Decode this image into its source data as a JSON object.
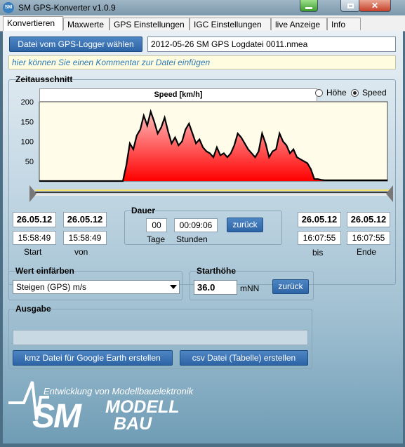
{
  "window": {
    "title": "SM GPS-Konverter v1.0.9",
    "icon_text": "SM",
    "close_symbol": "✕"
  },
  "tabs": [
    {
      "label": "Konvertieren",
      "active": true
    },
    {
      "label": "Maxwerte"
    },
    {
      "label": "GPS Einstellungen"
    },
    {
      "label": "IGC Einstellungen"
    },
    {
      "label": "live Anzeige"
    },
    {
      "label": "Info"
    }
  ],
  "file": {
    "button_label": "Datei vom GPS-Logger wählen",
    "filename": "2012-05-26 SM GPS Logdatei 0011.nmea",
    "comment_placeholder": "hier können Sie einen Kommentar zur Datei einfügen"
  },
  "zeitausschnitt": {
    "title": "Zeitausschnitt",
    "radio_hoehe": "Höhe",
    "radio_speed": "Speed",
    "selected": "Speed",
    "start_date": "26.05.12",
    "start_time": "15:58:49",
    "start_label": "Start",
    "von_date": "26.05.12",
    "von_time": "15:58:49",
    "von_label": "von",
    "dauer_title": "Dauer",
    "tage_value": "00",
    "stunden_value": "00:09:06",
    "tage_label": "Tage",
    "stunden_label": "Stunden",
    "zurueck_label": "zurück",
    "bis_date": "26.05.12",
    "bis_time": "16:07:55",
    "bis_label": "bis",
    "ende_date": "26.05.12",
    "ende_time": "16:07:55",
    "ende_label": "Ende"
  },
  "chart_data": {
    "type": "area",
    "title": "Speed [km/h]",
    "ylim": [
      0,
      200
    ],
    "yticks": [
      "200",
      "150",
      "100",
      "50"
    ],
    "x": [
      0,
      2,
      4,
      6,
      8,
      10,
      12,
      14,
      16,
      18,
      20,
      22,
      24,
      25,
      26,
      27,
      28,
      29,
      30,
      31,
      32,
      33,
      34,
      35,
      36,
      37,
      38,
      39,
      40,
      41,
      42,
      43,
      44,
      45,
      46,
      47,
      48,
      49,
      50,
      51,
      52,
      53,
      54,
      55,
      56,
      57,
      58,
      59,
      60,
      61,
      62,
      63,
      64,
      65,
      66,
      67,
      68,
      69,
      70,
      71,
      72,
      73,
      74,
      75,
      76,
      77,
      78,
      79,
      80,
      81,
      82,
      83,
      84,
      85,
      86,
      87,
      88,
      89,
      90,
      91,
      92,
      93,
      94,
      95,
      96,
      97,
      98,
      99,
      100
    ],
    "values": [
      0,
      0,
      0,
      0,
      0,
      0,
      0,
      0,
      0,
      0,
      0,
      0,
      0,
      40,
      95,
      80,
      115,
      130,
      165,
      140,
      175,
      150,
      120,
      135,
      160,
      125,
      95,
      110,
      90,
      100,
      130,
      145,
      120,
      95,
      105,
      85,
      75,
      70,
      60,
      85,
      65,
      70,
      60,
      70,
      90,
      120,
      110,
      95,
      80,
      70,
      60,
      75,
      120,
      95,
      60,
      75,
      80,
      120,
      100,
      90,
      70,
      80,
      60,
      55,
      50,
      45,
      30,
      5,
      5,
      3,
      2,
      2,
      2,
      2,
      2,
      2,
      2,
      2,
      2,
      2,
      2,
      2,
      2,
      2,
      2,
      2,
      2,
      2,
      2
    ],
    "fill_colors": [
      "#ffbcbc",
      "#ff0000"
    ],
    "line_color": "#000000",
    "background": "#fffde9"
  },
  "wert_einfaerben": {
    "title": "Wert einfärben",
    "selected": "Steigen (GPS) m/s"
  },
  "starthoehe": {
    "title": "Starthöhe",
    "value": "36.0",
    "unit": "mNN",
    "zurueck_label": "zurück"
  },
  "ausgabe": {
    "title": "Ausgabe",
    "progress": 0,
    "kmz_label": "kmz Datei für Google Earth erstellen",
    "csv_label": "csv Datei (Tabelle) erstellen"
  },
  "logo": {
    "tagline": "Entwicklung von Modellbauelektronik",
    "sm": "SM",
    "modell": "MODELL",
    "bau": "BAU"
  }
}
